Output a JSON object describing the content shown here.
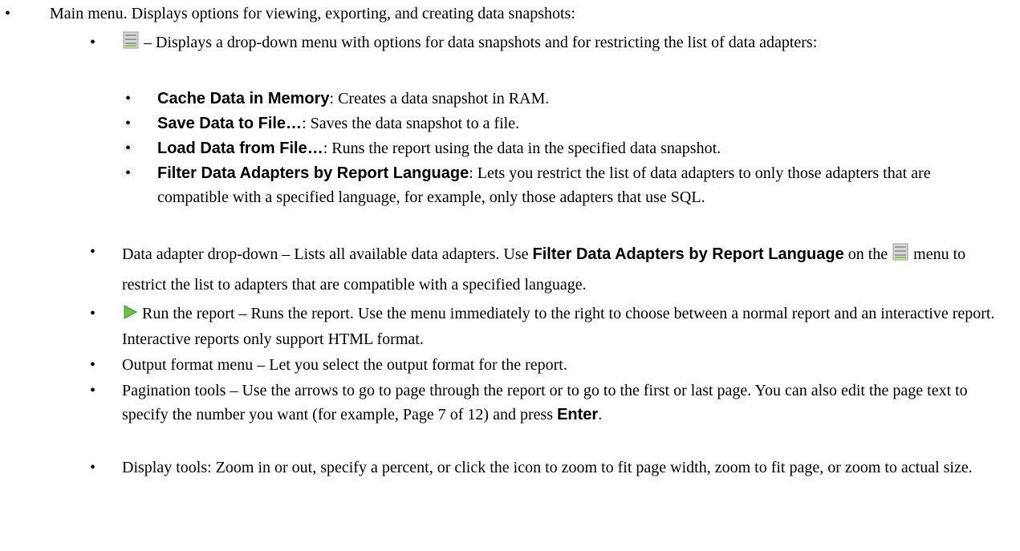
{
  "bullet_char": "•",
  "items": [
    {
      "text": "Main menu. Displays options for viewing, exporting, and creating data snapshots:",
      "children": [
        {
          "icon": "database-menu-icon",
          "text": "– Displays a drop-down menu with options for data snapshots and for restricting the list of data adapters:",
          "children": [
            {
              "bold": "Cache Data in Memory",
              "text": ": Creates a data snapshot in RAM."
            },
            {
              "bold": "Save Data to File…",
              "text": ": Saves the data snapshot to a file."
            },
            {
              "bold": "Load Data from File…",
              "text": ": Runs the report using the data in the specified data snapshot."
            },
            {
              "bold": "Filter Data Adapters by Report Language",
              "text": ": Lets you restrict the list of data adapters to only those adapters that are compatible with a specified language, for example, only those adapters that use SQL."
            }
          ]
        },
        {
          "text_a": "Data adapter drop-down – Lists all available data adapters. Use ",
          "bold": "Filter Data Adapters by Report Language",
          "text_b": " on the ",
          "icon": "database-menu-icon",
          "text_c": " menu to restrict the list to adapters that are compatible with a specified language."
        },
        {
          "icon": "run-play-icon",
          "text": "Run the report – Runs the report. Use the menu immediately to the right to choose between a normal report and an interactive report. Interactive reports only support HTML format."
        },
        {
          "text": "Output format menu – Let you select the output format for the report."
        },
        {
          "text": "Pagination tools – Use the arrows to go to page through the report or to go to the first or last page. You can also edit the page text to specify the number you want (for example, Page 7 of 12) and press ",
          "bold": "Enter",
          "tail": "."
        },
        {
          "text": "Display tools: Zoom in or out, specify a percent, or click the icon to zoom to fit page width, zoom to fit page, or zoom to actual size."
        }
      ]
    }
  ]
}
